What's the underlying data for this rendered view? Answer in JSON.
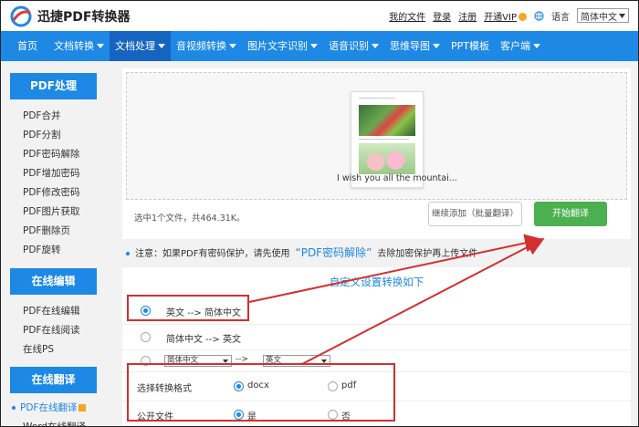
{
  "brand": {
    "name": "迅捷PDF转换器"
  },
  "toplinks": {
    "my_files": "我的文件",
    "login": "登录",
    "register": "注册",
    "vip": "开通VIP",
    "language": "语言",
    "lang_value": "简体中文"
  },
  "nav": [
    {
      "label": "首页"
    },
    {
      "label": "文档转换"
    },
    {
      "label": "文档处理"
    },
    {
      "label": "音视频转换"
    },
    {
      "label": "图片文字识别"
    },
    {
      "label": "语音识别"
    },
    {
      "label": "思维导图"
    },
    {
      "label": "PPT模板"
    },
    {
      "label": "客户端"
    }
  ],
  "sidebar": {
    "pdf_head": "PDF处理",
    "pdf_items": [
      "PDF合并",
      "PDF分割",
      "PDF密码解除",
      "PDF增加密码",
      "PDF修改密码",
      "PDF图片获取",
      "PDF删除页",
      "PDF旋转"
    ],
    "edit_head": "在线编辑",
    "edit_items": [
      "PDF在线编辑",
      "PDF在线阅读",
      "在线PS"
    ],
    "translate_head": "在线翻译",
    "translate_items": [
      "PDF在线翻译",
      "Word在线翻译"
    ]
  },
  "upload": {
    "file_name": "I wish you all the mountai...",
    "status": "选中1个文件，共464.31K。",
    "add_button": "继续添加（批量翻译）",
    "start_button": "开始翻译"
  },
  "notice": {
    "prefix": "注意：如果PDF有密码保护，请先使用",
    "link": "“PDF密码解除”",
    "suffix": "去除加密保护再上传文件"
  },
  "settings": {
    "title": "自定义设置转换如下",
    "option1": "英文 --> 简体中文",
    "option2": "简体中文 --> 英文",
    "custom_from": "简体中文",
    "custom_arrow": "-->",
    "custom_to": "英文",
    "format_label": "选择转换格式",
    "format_docx": "docx",
    "format_pdf": "pdf",
    "public_label": "公开文件",
    "public_yes": "是",
    "public_no": "否"
  },
  "colors": {
    "primary": "#1e88e5",
    "start": "#4caf50",
    "annotation": "#d32f2f"
  }
}
